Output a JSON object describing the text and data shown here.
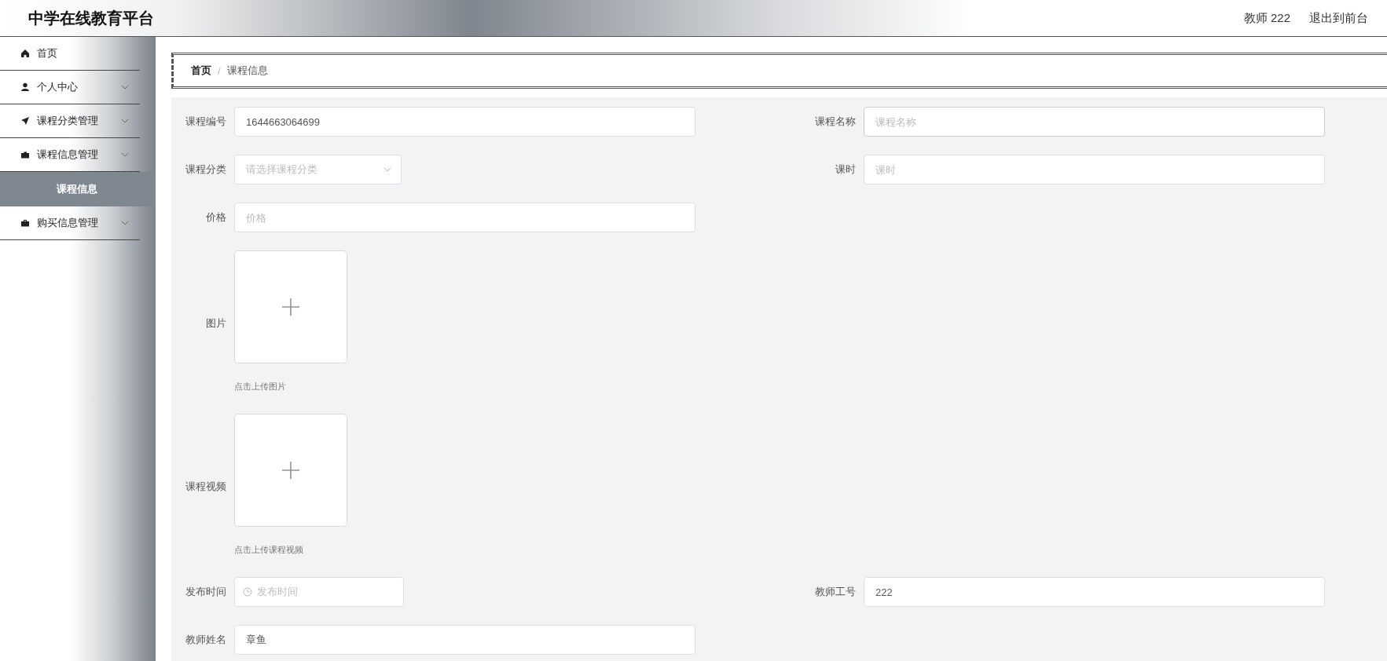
{
  "header": {
    "title": "中学在线教育平台",
    "user": "教师 222",
    "logout": "退出到前台"
  },
  "sidebar": {
    "items": [
      {
        "label": "首页",
        "has_arrow": false
      },
      {
        "label": "个人中心",
        "has_arrow": true
      },
      {
        "label": "课程分类管理",
        "has_arrow": true
      },
      {
        "label": "课程信息管理",
        "has_arrow": true,
        "children": [
          {
            "label": "课程信息",
            "selected": true
          }
        ]
      },
      {
        "label": "购买信息管理",
        "has_arrow": true
      }
    ]
  },
  "breadcrumb": {
    "separator": "/",
    "items": [
      "首页",
      "课程信息"
    ]
  },
  "form": {
    "rows": [
      [
        {
          "label": "课程编号",
          "kind": "text",
          "value": "1644663064699"
        },
        {
          "label": "课程名称",
          "kind": "text",
          "placeholder": "课程名称",
          "focused": true
        }
      ],
      [
        {
          "label": "课程分类",
          "kind": "select",
          "placeholder": "请选择课程分类"
        },
        {
          "label": "课时",
          "kind": "text",
          "placeholder": "课时"
        }
      ],
      [
        {
          "label": "价格",
          "kind": "text",
          "placeholder": "价格"
        }
      ],
      [
        {
          "label": "图片",
          "kind": "upload",
          "hint": "点击上传图片"
        }
      ],
      [
        {
          "label": "课程视频",
          "kind": "upload",
          "hint": "点击上传课程视频"
        }
      ],
      [
        {
          "label": "发布时间",
          "kind": "date",
          "placeholder": "发布时间"
        },
        {
          "label": "教师工号",
          "kind": "text",
          "value": "222"
        }
      ],
      [
        {
          "label": "教师姓名",
          "kind": "text",
          "value": "章鱼"
        }
      ]
    ]
  }
}
